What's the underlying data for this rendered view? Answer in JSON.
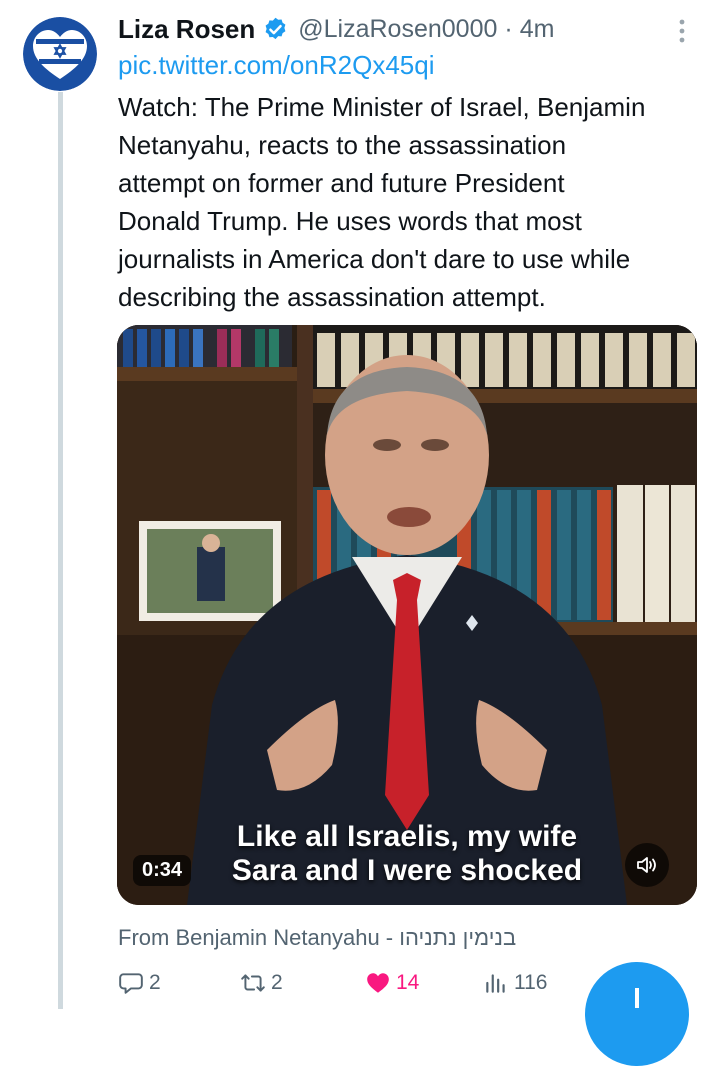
{
  "tweet": {
    "author_name": "Liza Rosen",
    "handle": "@LizaRosen0000",
    "separator": "·",
    "time_ago": "4m",
    "link": "pic.twitter.com/onR2Qx45qi",
    "text": "Watch: The Prime Minister of Israel, Benjamin\nNetanyahu, reacts to the assassination\nattempt on former and future President\nDonald Trump. He uses words that most\njournalists in America don't dare to use while\ndescribing the assassination attempt."
  },
  "video": {
    "caption_line1": "Like all Israelis, my wife",
    "caption_line2": "Sara and I were shocked",
    "duration": "0:34",
    "from_label": "From",
    "from_source": "Benjamin Netanyahu - בנימין נתניהו"
  },
  "actions": {
    "replies": "2",
    "retweets": "2",
    "likes": "14",
    "views": "116"
  },
  "colors": {
    "accent": "#1d9bf0",
    "like": "#f91880",
    "secondary_text": "#536471",
    "thread_line": "#cfd9de"
  },
  "icons": {
    "avatar": "israel-flag-heart-icon",
    "verified": "verified-badge-icon",
    "more": "more-vertical-icon",
    "mute": "speaker-muted-icon",
    "reply": "reply-icon",
    "retweet": "retweet-icon",
    "like": "heart-filled-icon",
    "views": "views-icon",
    "compose": "compose-fab"
  }
}
